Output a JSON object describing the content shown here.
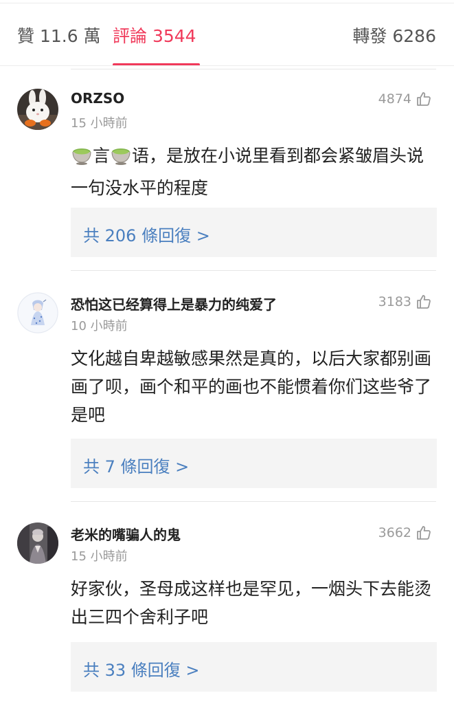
{
  "tabs": {
    "likes": "贊 11.6 萬",
    "comments": "評論 3544",
    "reposts": "轉發 6286",
    "active": "comments"
  },
  "comments": [
    {
      "username": "ORZSO",
      "time": "15 小時前",
      "likes": "4874",
      "body_parts": [
        "言",
        "语，是放在小说里看到都会紧皱眉头说一句没水平的程度"
      ],
      "emoji": "teacup-emoji",
      "replies": "共 206 條回復 >",
      "avatar": "rabbit-avatar"
    },
    {
      "username": "恐怕这已经算得上是暴力的纯爱了",
      "time": "10 小時前",
      "likes": "3183",
      "body": "文化越自卑越敏感果然是真的，以后大家都别画画了呗，画个和平的画也不能惯着你们这些爷了是吧",
      "replies": "共 7 條回復 >",
      "avatar": "anime-girl-avatar"
    },
    {
      "username": "老米的嘴骗人的鬼",
      "time": "15 小時前",
      "likes": "3662",
      "body": "好家伙，圣母成这样也是罕见，一烟头下去能烫出三四个舍利子吧",
      "replies": "共 33 條回復 >",
      "avatar": "figure-avatar"
    }
  ],
  "colors": {
    "accent": "#f0395a",
    "link": "#4a7fbf",
    "muted": "#9a9a9a",
    "reply_bg": "#f4f4f4"
  }
}
